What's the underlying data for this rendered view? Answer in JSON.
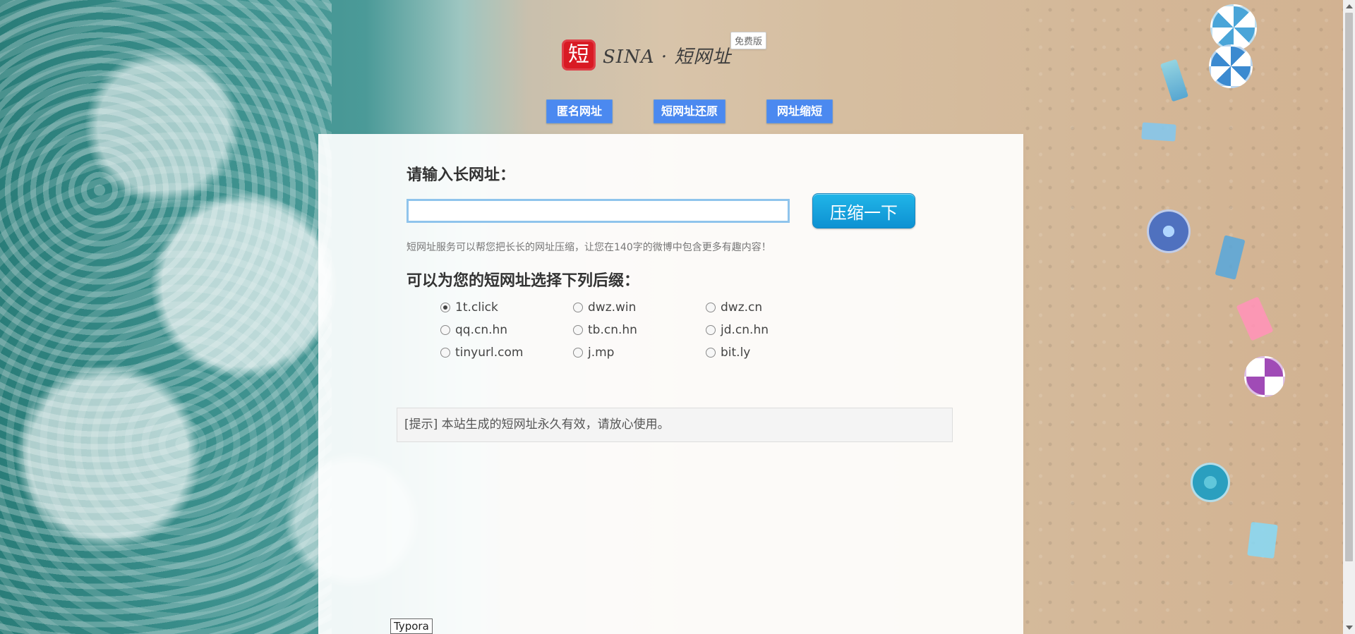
{
  "header": {
    "logo_symbol": "短",
    "logo_text": "SINA · 短网址",
    "badge": "免费版"
  },
  "nav": {
    "items": [
      {
        "label": "匿名网址"
      },
      {
        "label": "短网址还原"
      },
      {
        "label": "网址缩短"
      }
    ]
  },
  "form": {
    "long_url_label": "请输入长网址：",
    "long_url_value": "",
    "long_url_placeholder": "",
    "submit_label": "压缩一下",
    "description": "短网址服务可以帮您把长长的网址压缩，让您在140字的微博中包含更多有趣内容！",
    "suffix_label": "可以为您的短网址选择下列后缀：",
    "suffixes": [
      {
        "label": "1t.click",
        "checked": true
      },
      {
        "label": "dwz.win",
        "checked": false
      },
      {
        "label": "dwz.cn",
        "checked": false
      },
      {
        "label": "qq.cn.hn",
        "checked": false
      },
      {
        "label": "tb.cn.hn",
        "checked": false
      },
      {
        "label": "jd.cn.hn",
        "checked": false
      },
      {
        "label": "tinyurl.com",
        "checked": false
      },
      {
        "label": "j.mp",
        "checked": false
      },
      {
        "label": "bit.ly",
        "checked": false
      }
    ]
  },
  "notice": {
    "text": "[提示] 本站生成的短网址永久有效，请放心使用。"
  },
  "tooltip": {
    "text": "Typora"
  },
  "colors": {
    "nav_blue": "#4b89f0",
    "button_blue": "#1297d5",
    "input_border": "#8fc4ec"
  }
}
